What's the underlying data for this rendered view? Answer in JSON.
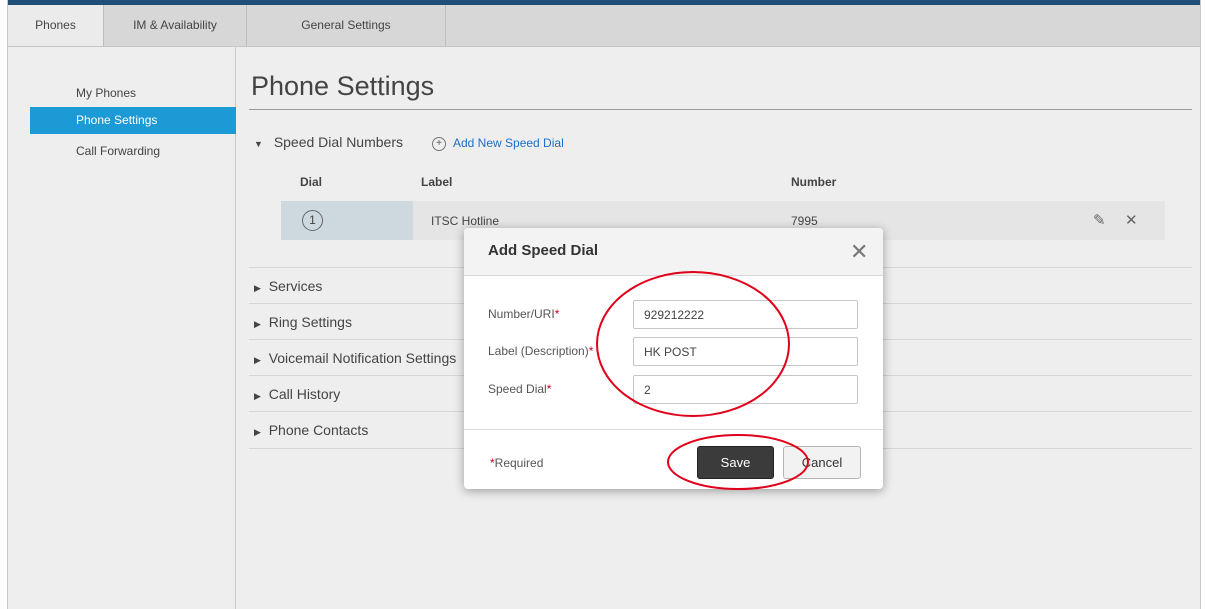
{
  "tabs": [
    {
      "label": "Phones"
    },
    {
      "label": "IM & Availability"
    },
    {
      "label": "General Settings"
    }
  ],
  "sidebar": {
    "items": [
      {
        "label": "My Phones"
      },
      {
        "label": "Phone Settings"
      },
      {
        "label": "Call Forwarding"
      }
    ]
  },
  "page": {
    "title": "Phone Settings"
  },
  "speed_dial": {
    "section_label": "Speed Dial Numbers",
    "add_link": "Add New Speed Dial",
    "columns": {
      "dial": "Dial",
      "label": "Label",
      "number": "Number"
    },
    "rows": [
      {
        "dial": "1",
        "label": "ITSC Hotline",
        "number": "7995"
      }
    ]
  },
  "sections": [
    {
      "label": "Services"
    },
    {
      "label": "Ring Settings"
    },
    {
      "label": "Voicemail Notification Settings"
    },
    {
      "label": "Call History"
    },
    {
      "label": "Phone Contacts"
    }
  ],
  "modal": {
    "title": "Add Speed Dial",
    "fields": {
      "number": {
        "label": "Number/URI",
        "value": "929212222"
      },
      "label": {
        "label": "Label (Description)",
        "value": "HK POST"
      },
      "speed_dial": {
        "label": "Speed Dial",
        "value": "2"
      }
    },
    "required_marker": "*",
    "required_note": "Required",
    "save_label": "Save",
    "cancel_label": "Cancel"
  },
  "colors": {
    "accent": "#1c9ad6",
    "link": "#1e6fc8",
    "required": "#d0021b",
    "annotation": "#e0001b"
  },
  "icons": {
    "add": "plus-circle-icon",
    "edit": "pencil-icon",
    "delete": "close-icon",
    "expand": "triangle-right-icon",
    "collapse": "triangle-down-icon"
  }
}
